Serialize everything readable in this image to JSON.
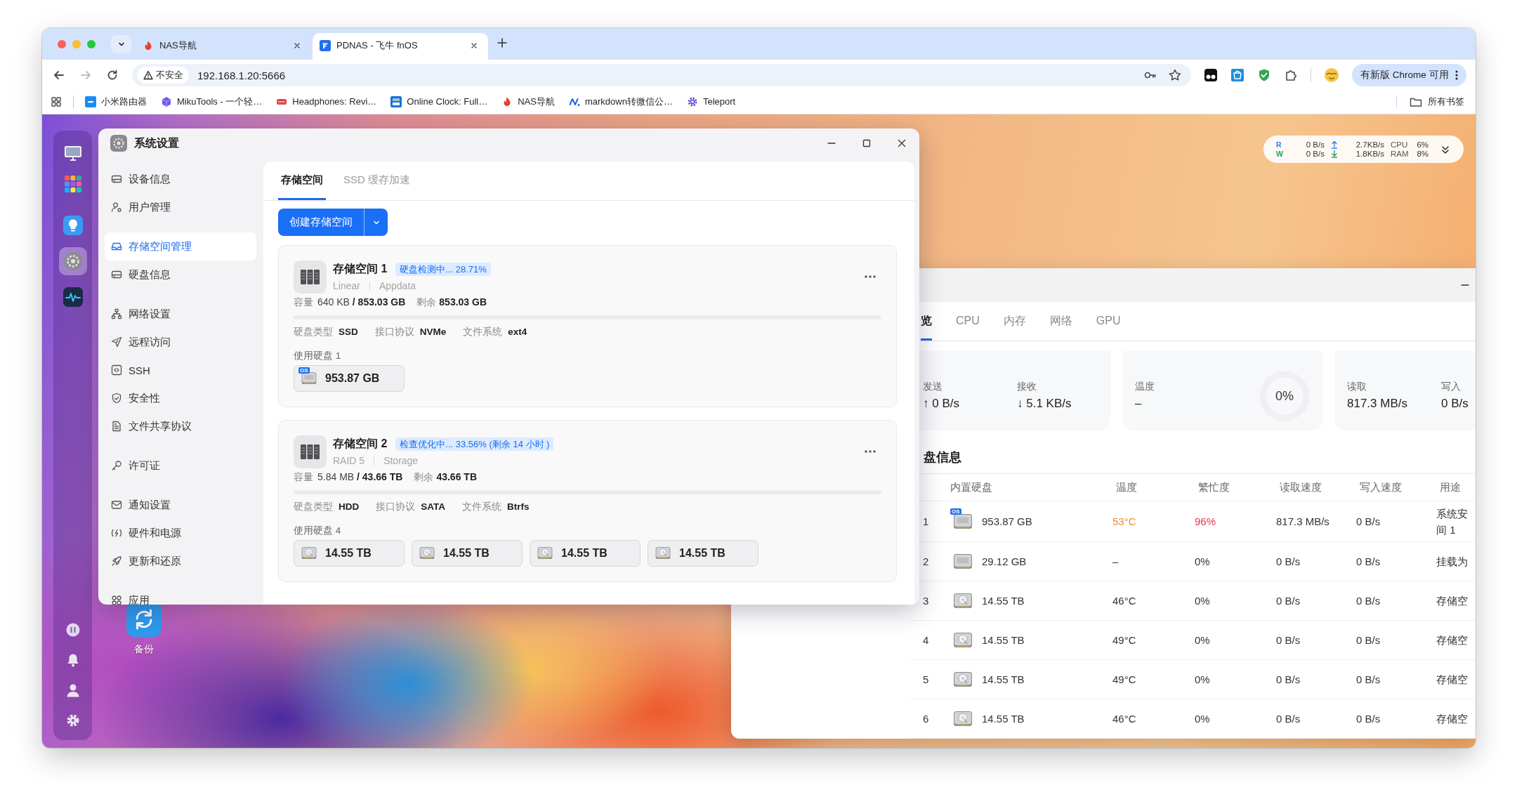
{
  "browser": {
    "tabs": [
      {
        "title": "NAS导航",
        "selected": false
      },
      {
        "title": "PDNAS - 飞牛 fnOS",
        "selected": true
      }
    ],
    "forward_disabled": true,
    "address_bar": {
      "security_label": "不安全",
      "url": "192.168.1.20:5666"
    },
    "update_button": "有新版 Chrome 可用",
    "bookmarks": [
      "小米路由器",
      "MikuTools - 一个轻…",
      "Headphones: Revi…",
      "Online Clock: Full…",
      "NAS导航",
      "markdown转微信公…",
      "Teleport"
    ],
    "all_bookmarks": "所有书签"
  },
  "desktop": {
    "dock_apps": [
      {
        "selected": false
      },
      {
        "selected": false
      },
      {
        "selected": false
      },
      {
        "selected": true
      },
      {
        "selected": false
      }
    ],
    "widget": {
      "rows": [
        {
          "label": "R",
          "color": "#2f7cf6",
          "disk": "0 B/s",
          "kind": "up",
          "net": "2.7KB/s",
          "metric": "CPU",
          "percent": "6%"
        },
        {
          "label": "W",
          "color": "#1ea460",
          "disk": "0 B/s",
          "kind": "down",
          "net": "1.8KB/s",
          "metric": "RAM",
          "percent": "8%"
        }
      ]
    },
    "shortcuts": [
      {
        "label": "备份"
      }
    ]
  },
  "settings_window": {
    "title": "系统设置",
    "sidebar_groups": [
      [
        {
          "label": "设备信息",
          "selected": false
        },
        {
          "label": "用户管理",
          "selected": false
        }
      ],
      [
        {
          "label": "存储空间管理",
          "selected": true
        },
        {
          "label": "硬盘信息",
          "selected": false
        }
      ],
      [
        {
          "label": "网络设置",
          "selected": false
        },
        {
          "label": "远程访问",
          "selected": false
        },
        {
          "label": "SSH",
          "selected": false
        },
        {
          "label": "安全性",
          "selected": false
        },
        {
          "label": "文件共享协议",
          "selected": false
        }
      ],
      [
        {
          "label": "许可证",
          "selected": false
        }
      ],
      [
        {
          "label": "通知设置",
          "selected": false
        },
        {
          "label": "硬件和电源",
          "selected": false
        },
        {
          "label": "更新和还原",
          "selected": false
        }
      ],
      [
        {
          "label": "应用",
          "selected": false
        }
      ]
    ],
    "tabs": [
      {
        "label": "存储空间",
        "selected": true
      },
      {
        "label": "SSD 缓存加速",
        "selected": false
      }
    ],
    "create_button": "创建存储空间",
    "pools": [
      {
        "title": "存储空间 1",
        "status": "硬盘检测中... 28.71%",
        "raid": "Linear",
        "name": "Appdata",
        "capacity_label": "容量",
        "capacity": "640 KB **/ 853.03 GB**",
        "free_label": "剩余",
        "free": "853.03 GB",
        "level": 0,
        "specs": [
          {
            "label": "硬盘类型",
            "value": "SSD"
          },
          {
            "label": "接口协议",
            "value": "NVMe"
          },
          {
            "label": "文件系统",
            "value": "ext4"
          }
        ],
        "disks_label": "使用硬盘 1",
        "disks": [
          {
            "kind": "ssd",
            "badge": "OS",
            "size": "953.87 GB"
          }
        ]
      },
      {
        "title": "存储空间 2",
        "status": "检查优化中... 33.56% (剩余 14 小时 )",
        "raid": "RAID 5",
        "name": "Storage",
        "capacity_label": "容量",
        "capacity": "5.84 MB **/ 43.66 TB**",
        "free_label": "剩余",
        "free": "43.66 TB",
        "level": 0,
        "specs": [
          {
            "label": "硬盘类型",
            "value": "HDD"
          },
          {
            "label": "接口协议",
            "value": "SATA"
          },
          {
            "label": "文件系统",
            "value": "Btrfs"
          }
        ],
        "disks_label": "使用硬盘 4",
        "disks": [
          {
            "kind": "hdd",
            "size": "14.55 TB"
          },
          {
            "kind": "hdd",
            "size": "14.55 TB"
          },
          {
            "kind": "hdd",
            "size": "14.55 TB"
          },
          {
            "kind": "hdd",
            "size": "14.55 TB"
          }
        ]
      }
    ]
  },
  "monitor_window": {
    "tabs": [
      {
        "label": "览",
        "selected": true
      },
      {
        "label": "CPU",
        "selected": false
      },
      {
        "label": "内存",
        "selected": false
      },
      {
        "label": "网络",
        "selected": false
      },
      {
        "label": "GPU",
        "selected": false
      }
    ],
    "cards": [
      {
        "stats": [
          {
            "label": "发送",
            "value": "↑ 0 B/s"
          },
          {
            "label": "接收",
            "value": "↓ 5.1 KB/s"
          }
        ]
      },
      {
        "stats": [
          {
            "label": "温度",
            "value": "–"
          }
        ],
        "gauge": {
          "reading": "0%"
        }
      },
      {
        "stats": [
          {
            "label": "读取",
            "value": "817.3 MB/s"
          },
          {
            "label": "写入",
            "value": "0 B/s"
          }
        ]
      }
    ],
    "disk_table": {
      "title": "盘信息",
      "columns": [
        "内置硬盘",
        "温度",
        "繁忙度",
        "读取速度",
        "写入速度",
        "用途"
      ],
      "rows": [
        {
          "index": "1",
          "kind": "ssd",
          "badge": "OS",
          "size": "953.87 GB",
          "temp": "53°C",
          "temp_warning": true,
          "busy": "96%",
          "busy_high": true,
          "read": "817.3 MB/s",
          "write": "0 B/s",
          "usage": [
            "系统安",
            "间 1"
          ]
        },
        {
          "index": "2",
          "kind": "ssd",
          "size": "29.12 GB",
          "temp": "–",
          "temp_warning": false,
          "busy": "0%",
          "busy_high": false,
          "read": "0 B/s",
          "write": "0 B/s",
          "usage": [
            "挂载为"
          ]
        },
        {
          "index": "3",
          "kind": "hdd",
          "size": "14.55 TB",
          "temp": "46°C",
          "temp_warning": false,
          "busy": "0%",
          "busy_high": false,
          "read": "0 B/s",
          "write": "0 B/s",
          "usage": [
            "存储空"
          ]
        },
        {
          "index": "4",
          "kind": "hdd",
          "size": "14.55 TB",
          "temp": "49°C",
          "temp_warning": false,
          "busy": "0%",
          "busy_high": false,
          "read": "0 B/s",
          "write": "0 B/s",
          "usage": [
            "存储空"
          ]
        },
        {
          "index": "5",
          "kind": "hdd",
          "size": "14.55 TB",
          "temp": "49°C",
          "temp_warning": false,
          "busy": "0%",
          "busy_high": false,
          "read": "0 B/s",
          "write": "0 B/s",
          "usage": [
            "存储空"
          ]
        },
        {
          "index": "6",
          "kind": "hdd",
          "size": "14.55 TB",
          "temp": "46°C",
          "temp_warning": false,
          "busy": "0%",
          "busy_high": false,
          "read": "0 B/s",
          "write": "0 B/s",
          "usage": [
            "存储空"
          ]
        }
      ]
    }
  }
}
